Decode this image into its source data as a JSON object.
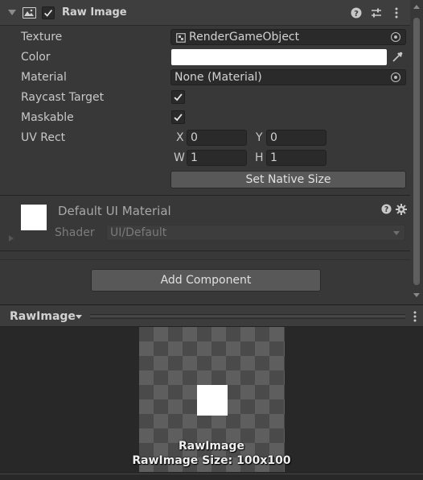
{
  "component": {
    "title": "Raw Image",
    "enabled": true,
    "icons": [
      "image-icon",
      "help-icon",
      "presets-icon",
      "context-menu-icon"
    ]
  },
  "fields": {
    "texture_label": "Texture",
    "texture_value": "RenderGameObject",
    "color_label": "Color",
    "color_value": "#FFFFFF",
    "material_label": "Material",
    "material_value": "None (Material)",
    "raycast_label": "Raycast Target",
    "raycast_checked": true,
    "maskable_label": "Maskable",
    "maskable_checked": true,
    "uvrect_label": "UV Rect",
    "uv_x_label": "X",
    "uv_x_value": "0",
    "uv_y_label": "Y",
    "uv_y_value": "0",
    "uv_w_label": "W",
    "uv_w_value": "1",
    "uv_h_label": "H",
    "uv_h_value": "1",
    "native_size_button": "Set Native Size"
  },
  "material": {
    "name": "Default UI Material",
    "shader_label": "Shader",
    "shader_value": "UI/Default"
  },
  "add_component_button": "Add Component",
  "preview": {
    "title": "RawImage",
    "caption_name": "RawImage",
    "caption_size": "RawImage Size: 100x100"
  },
  "colors": {
    "panel_bg": "#383838",
    "header_bg": "#3e3e3e",
    "field_bg": "#2a2a2a",
    "button_bg": "#585858",
    "preview_bg": "#282828"
  }
}
